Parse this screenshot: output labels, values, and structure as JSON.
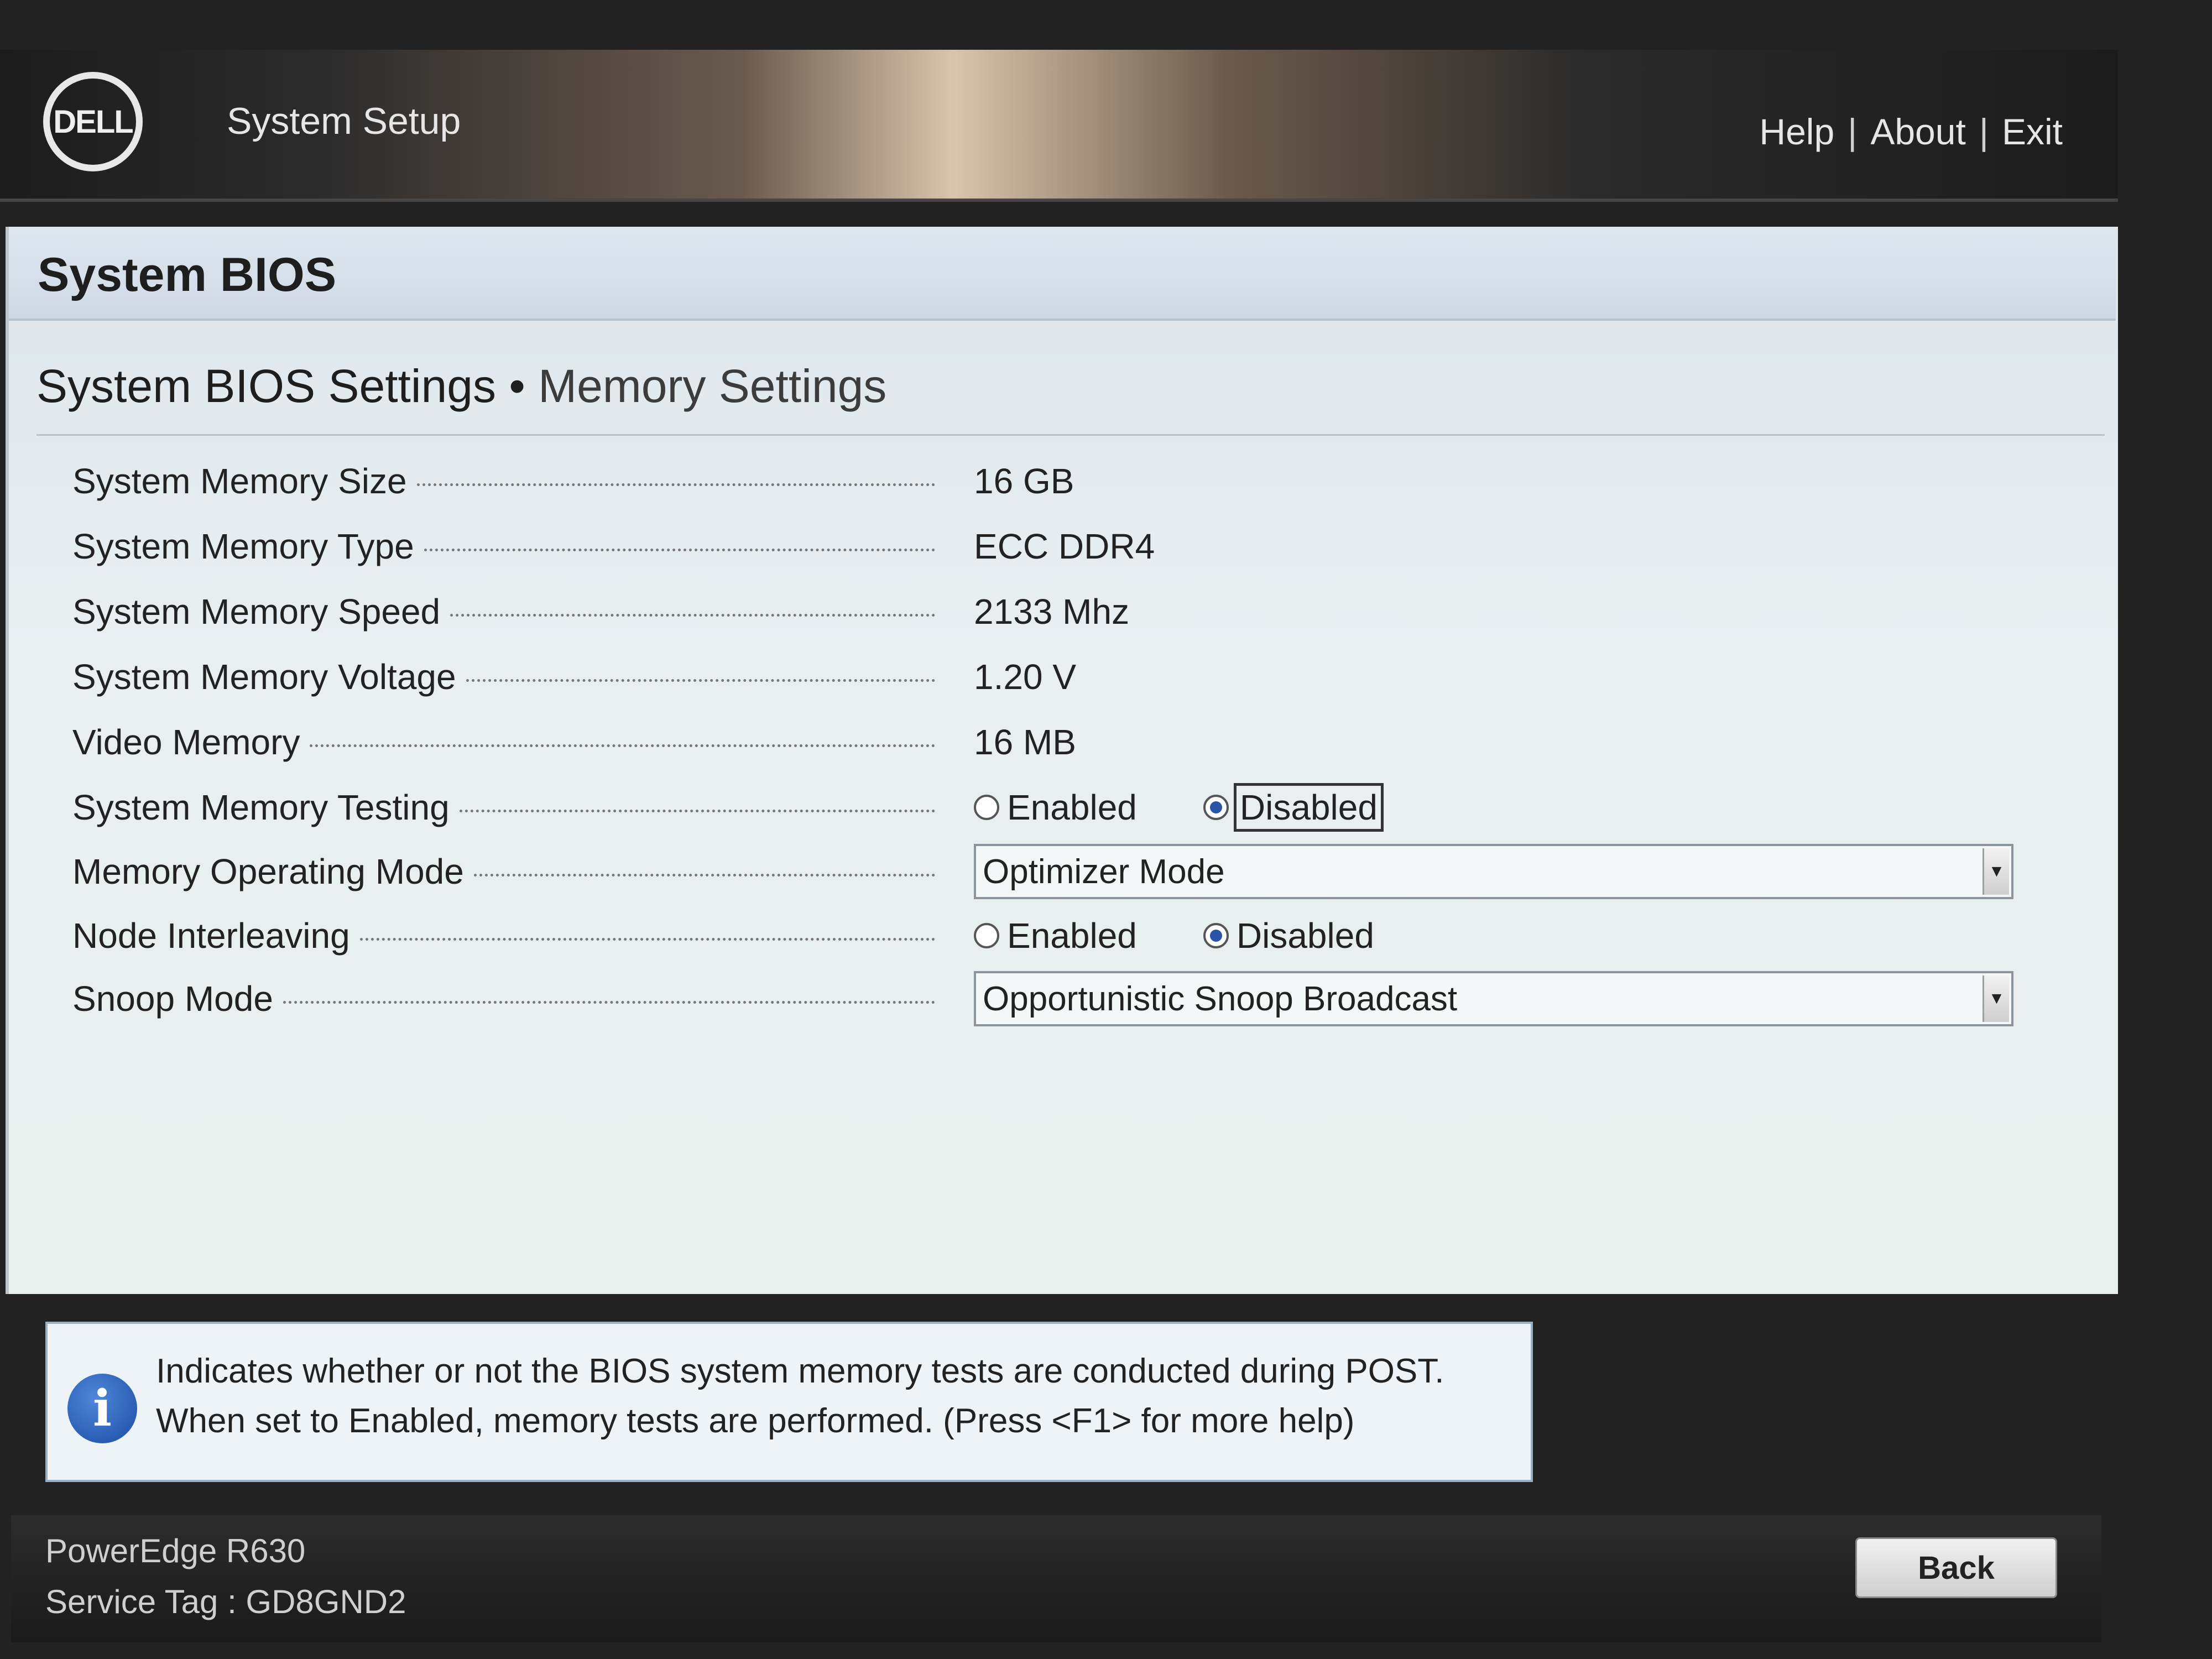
{
  "header": {
    "logo_text": "DELL",
    "app_title": "System Setup",
    "links": [
      "Help",
      "About",
      "Exit"
    ],
    "separator": "|"
  },
  "section": {
    "title": "System BIOS"
  },
  "breadcrumb": {
    "parent": "System BIOS Settings",
    "separator": "•",
    "current": "Memory Settings"
  },
  "settings": {
    "memory_size": {
      "label": "System Memory Size",
      "value": "16 GB"
    },
    "memory_type": {
      "label": "System Memory Type",
      "value": "ECC DDR4"
    },
    "memory_speed": {
      "label": "System Memory Speed",
      "value": "2133 Mhz"
    },
    "memory_voltage": {
      "label": "System Memory Voltage",
      "value": "1.20 V"
    },
    "video_memory": {
      "label": "Video Memory",
      "value": "16 MB"
    },
    "memory_testing": {
      "label": "System Memory Testing",
      "options": [
        "Enabled",
        "Disabled"
      ],
      "selected": "Disabled"
    },
    "operating_mode": {
      "label": "Memory Operating Mode",
      "value": "Optimizer Mode"
    },
    "node_interleaving": {
      "label": "Node Interleaving",
      "options": [
        "Enabled",
        "Disabled"
      ],
      "selected": "Disabled"
    },
    "snoop_mode": {
      "label": "Snoop Mode",
      "value": "Opportunistic Snoop Broadcast"
    }
  },
  "help": {
    "icon": "info-icon",
    "line1": "Indicates whether or not the BIOS system memory tests are conducted during POST.",
    "line2": "When set to Enabled, memory tests are performed. (Press <F1> for more help)"
  },
  "footer": {
    "model": "PowerEdge R630",
    "service_tag": "Service Tag : GD8GND2",
    "back_label": "Back"
  },
  "colors": {
    "radio_selected": "#2a54a8",
    "panel_bg": "#e9eff1",
    "header_bar": "#1c1c1c"
  }
}
